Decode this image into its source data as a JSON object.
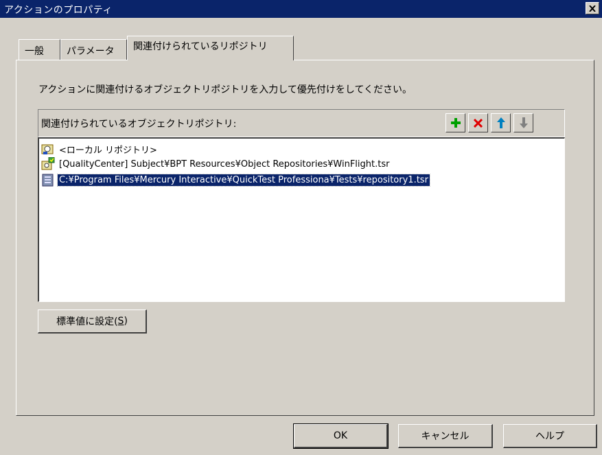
{
  "window": {
    "title": "アクションのプロパティ"
  },
  "tabs": [
    {
      "label": "一般"
    },
    {
      "label": "パラメータ"
    },
    {
      "label": "関連付けられているリポジトリ"
    }
  ],
  "instruction": "アクションに関連付けるオブジェクトリポジトリを入力して優先付けをしてください。",
  "repo_list": {
    "header": "関連付けられているオブジェクトリポジトリ:",
    "toolbar": [
      {
        "icon": "plus-icon",
        "color": "#008000"
      },
      {
        "icon": "delete-x-icon",
        "color": "#e00000"
      },
      {
        "icon": "arrow-up-icon",
        "color": "#0080c0"
      },
      {
        "icon": "arrow-down-icon",
        "color": "#808080"
      }
    ],
    "items": [
      {
        "text": "<ローカル リポジトリ>",
        "icon": "local-repository-icon"
      },
      {
        "text": "[QualityCenter] Subject¥BPT Resources¥Object Repositories¥WinFlight.tsr",
        "icon": "qc-repository-icon"
      },
      {
        "text": "C:¥Program Files¥Mercury Interactive¥QuickTest Professiona¥Tests¥repository1.tsr",
        "icon": "file-repository-icon",
        "selected": true
      }
    ]
  },
  "buttons": {
    "set_default": "標準値に設定(",
    "set_default_key": "S",
    "set_default_end": ")",
    "ok": "OK",
    "cancel": "キャンセル",
    "help": "ヘルプ"
  },
  "colors": {
    "titlebar": "#0a246a",
    "face": "#d4d0c8",
    "selection": "#0a246a"
  }
}
